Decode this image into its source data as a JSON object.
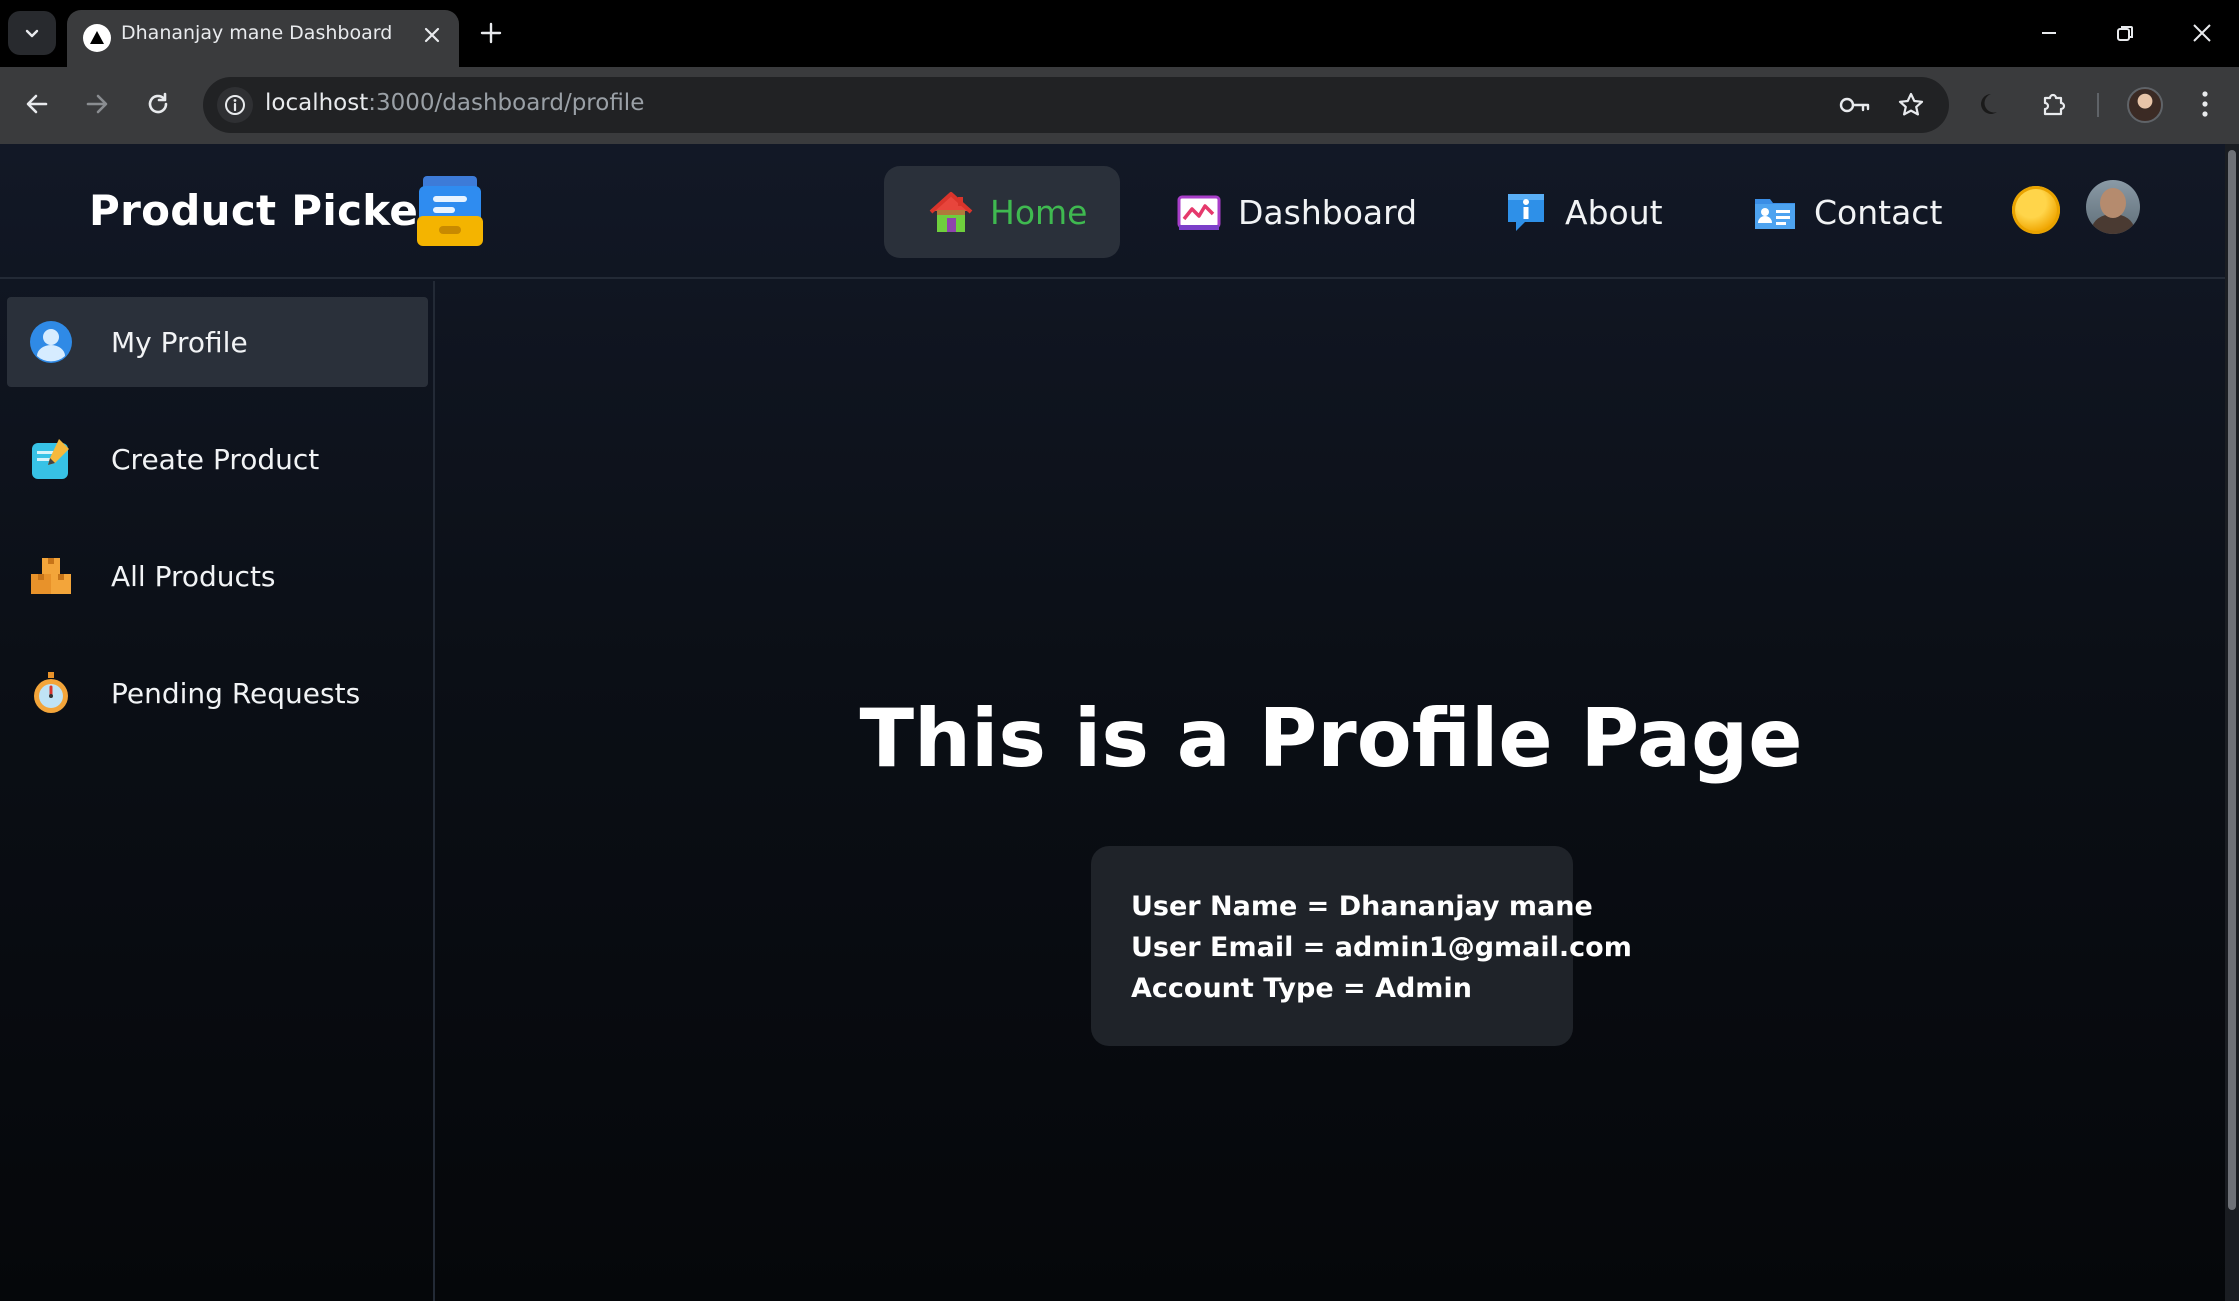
{
  "browser": {
    "tab_title": "Dhananjay mane Dashboard",
    "url_host": "localhost",
    "url_rest": ":3000/dashboard/profile"
  },
  "app": {
    "brand": "Product Picker",
    "nav": [
      {
        "label": "Home",
        "icon": "house-icon",
        "active": true
      },
      {
        "label": "Dashboard",
        "icon": "chart-icon",
        "active": false
      },
      {
        "label": "About",
        "icon": "info-icon",
        "active": false
      },
      {
        "label": "Contact",
        "icon": "contact-card-icon",
        "active": false
      }
    ],
    "accent_color": "#3fb950"
  },
  "sidebar": {
    "items": [
      {
        "label": "My Profile",
        "icon": "user-icon",
        "active": true
      },
      {
        "label": "Create Product",
        "icon": "memo-icon",
        "active": false
      },
      {
        "label": "All Products",
        "icon": "boxes-icon",
        "active": false
      },
      {
        "label": "Pending Requests",
        "icon": "stopwatch-icon",
        "active": false
      }
    ]
  },
  "profile": {
    "title": "This is a Profile Page",
    "user_name": "User Name = Dhananjay mane",
    "user_email": "User Email = admin1@gmail.com",
    "account_type": "Account Type = Admin"
  }
}
